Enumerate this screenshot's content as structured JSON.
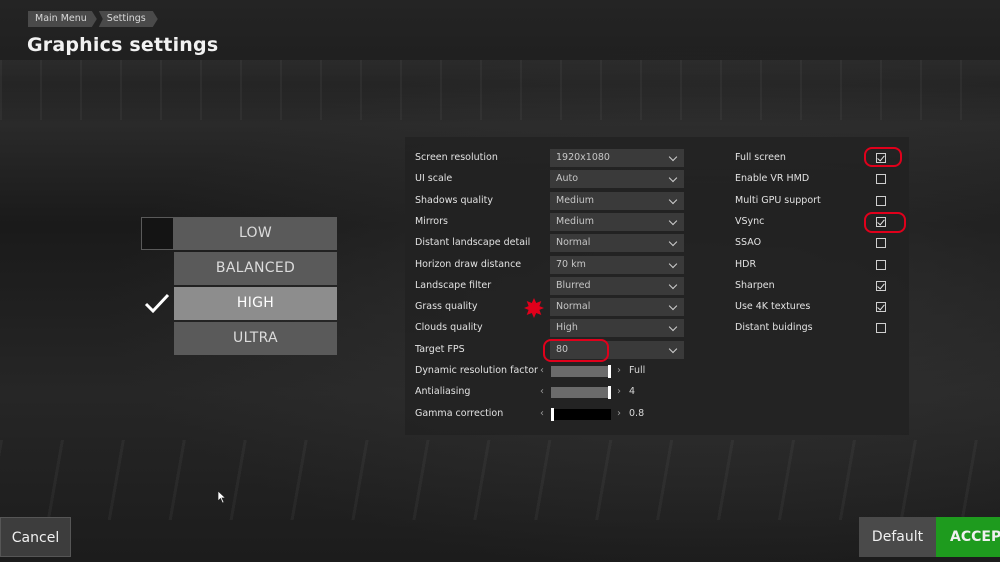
{
  "breadcrumb": {
    "items": [
      "Main Menu",
      "Settings"
    ]
  },
  "page": {
    "title": "Graphics settings"
  },
  "presets": {
    "items": [
      "LOW",
      "BALANCED",
      "HIGH",
      "ULTRA"
    ],
    "selected": "HIGH"
  },
  "settings": {
    "dropdowns": [
      {
        "label": "Screen resolution",
        "value": "1920x1080"
      },
      {
        "label": "UI scale",
        "value": "Auto"
      },
      {
        "label": "Shadows quality",
        "value": "Medium"
      },
      {
        "label": "Mirrors",
        "value": "Medium"
      },
      {
        "label": "Distant landscape detail",
        "value": "Normal"
      },
      {
        "label": "Horizon draw distance",
        "value": "70 km"
      },
      {
        "label": "Landscape filter",
        "value": "Blurred"
      },
      {
        "label": "Grass quality",
        "value": "Normal"
      },
      {
        "label": "Clouds quality",
        "value": "High"
      },
      {
        "label": "Target FPS",
        "value": "80"
      }
    ],
    "sliders": [
      {
        "label": "Dynamic resolution factor",
        "value": "Full",
        "level": 1.0
      },
      {
        "label": "Antialiasing",
        "value": "4",
        "level": 1.0
      },
      {
        "label": "Gamma correction",
        "value": "0.8",
        "level": 0.0
      }
    ],
    "checkboxes": [
      {
        "label": "Full screen",
        "checked": true
      },
      {
        "label": "Enable VR HMD",
        "checked": false
      },
      {
        "label": "Multi GPU support",
        "checked": false
      },
      {
        "label": "VSync",
        "checked": true
      },
      {
        "label": "SSAO",
        "checked": false
      },
      {
        "label": "HDR",
        "checked": false
      },
      {
        "label": "Sharpen",
        "checked": true
      },
      {
        "label": "Use 4K textures",
        "checked": true
      },
      {
        "label": "Distant buidings",
        "checked": false
      }
    ]
  },
  "buttons": {
    "cancel": "Cancel",
    "default": "Default",
    "accept": "ACCEPT"
  },
  "colors": {
    "accept": "#1e9b1e",
    "annotation": "#e0001b",
    "selected_preset": "#8d8d8d"
  }
}
